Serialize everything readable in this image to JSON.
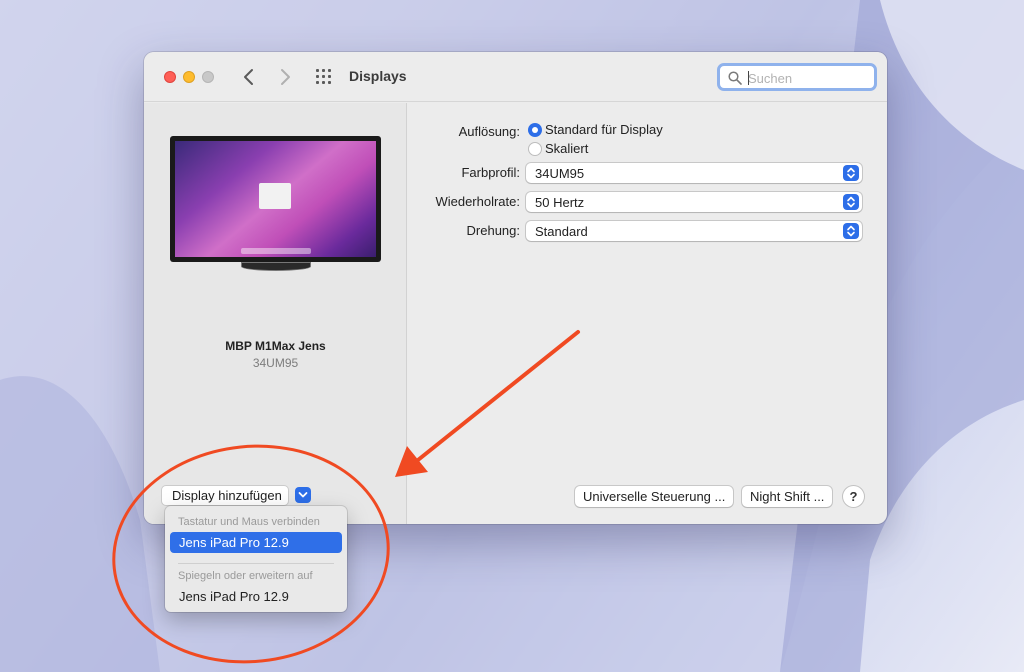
{
  "window": {
    "title": "Displays",
    "search_placeholder": "Suchen"
  },
  "display": {
    "name": "MBP M1Max Jens",
    "model": "34UM95"
  },
  "settings": {
    "resolution": {
      "label": "Auflösung:",
      "options": [
        "Standard für Display",
        "Skaliert"
      ],
      "selected": "Standard für Display"
    },
    "color_profile": {
      "label": "Farbprofil:",
      "value": "34UM95"
    },
    "refresh_rate": {
      "label": "Wiederholrate:",
      "value": "50 Hertz"
    },
    "rotation": {
      "label": "Drehung:",
      "value": "Standard"
    }
  },
  "footer": {
    "add_display": "Display hinzufügen",
    "universal_control": "Universelle Steuerung ...",
    "night_shift": "Night Shift ...",
    "help": "?"
  },
  "add_display_menu": {
    "section1_header": "Tastatur und Maus verbinden",
    "section1_items": [
      "Jens iPad Pro 12.9"
    ],
    "section2_header": "Spiegeln oder erweitern auf",
    "section2_items": [
      "Jens iPad Pro 12.9"
    ],
    "selected": "Jens iPad Pro 12.9"
  },
  "colors": {
    "accent": "#2d6ee8",
    "annotation": "#f04a22"
  }
}
